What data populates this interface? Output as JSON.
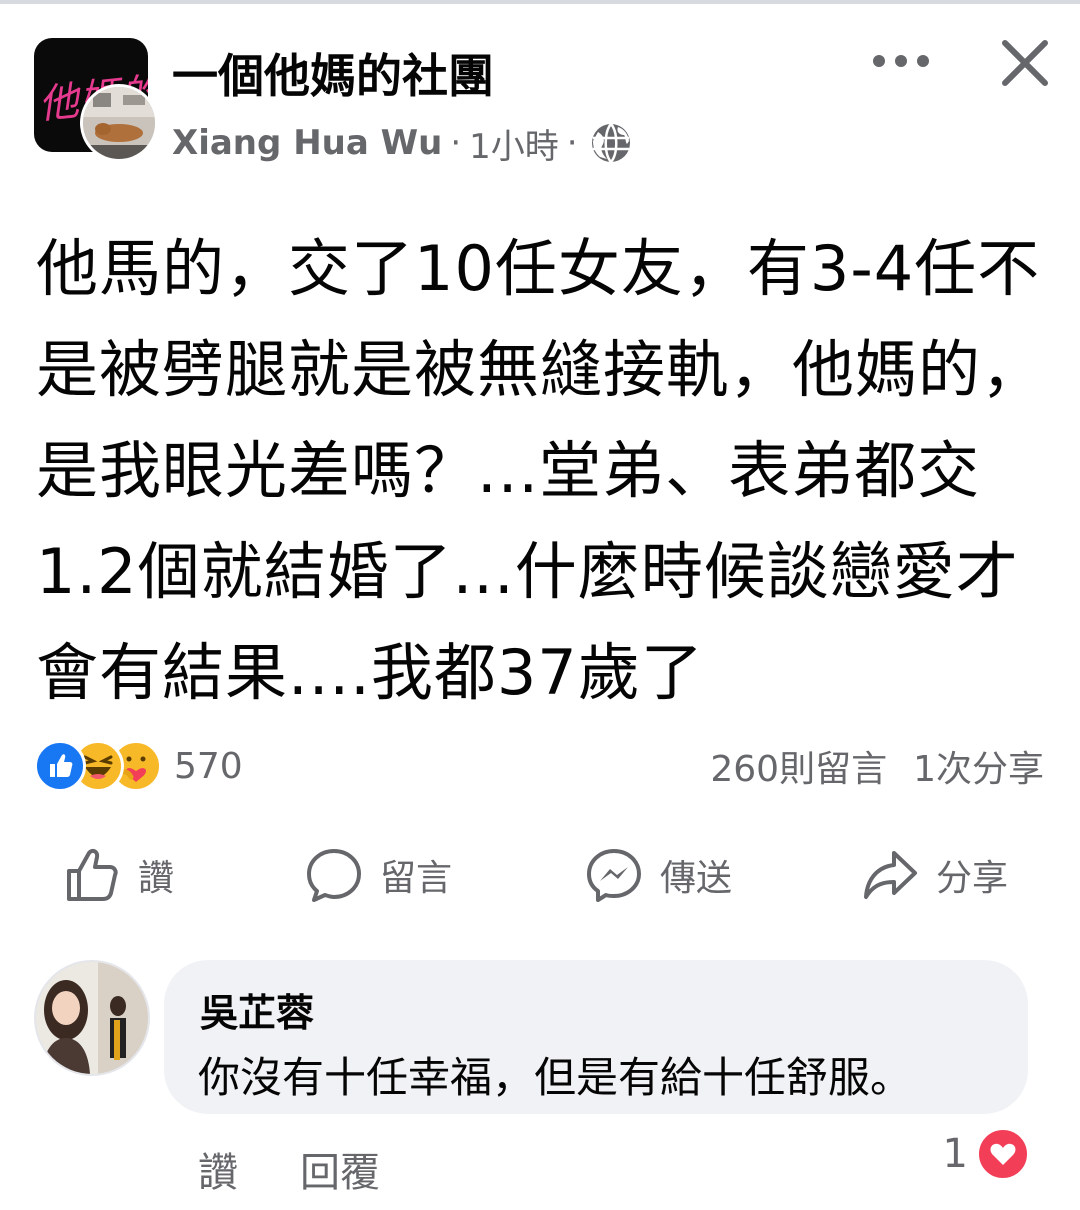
{
  "post": {
    "group_name": "一個他媽的社團",
    "group_logo_text": "他媽的",
    "author": "Xiang Hua Wu",
    "separator": "·",
    "time": "1小時",
    "privacy_icon": "globe-icon",
    "text": "他馬的，交了10任女友，有3-4任不是被劈腿就是被無縫接軌，他媽的，是我眼光差嗎？...堂弟、表弟都交1.2個就結婚了...什麼時候談戀愛才會有結果....我都37歲了"
  },
  "reactions": {
    "types": [
      "like-reaction-icon",
      "haha-reaction-icon",
      "care-reaction-icon"
    ],
    "count": "570",
    "comments": "260則留言",
    "shares": "1次分享"
  },
  "actions": {
    "like": "讚",
    "comment": "留言",
    "send": "傳送",
    "share": "分享"
  },
  "comment": {
    "author": "吳芷蓉",
    "text": "你沒有十任幸福，但是有給十任舒服。",
    "like_label": "讚",
    "reply_label": "回覆",
    "reaction_count": "1",
    "reaction_icon": "love-reaction-icon"
  },
  "colors": {
    "text_primary": "#050505",
    "text_secondary": "#65676b",
    "like_blue": "#1877f2",
    "bubble_bg": "#f0f2f5",
    "love_red": "#f33e58"
  }
}
